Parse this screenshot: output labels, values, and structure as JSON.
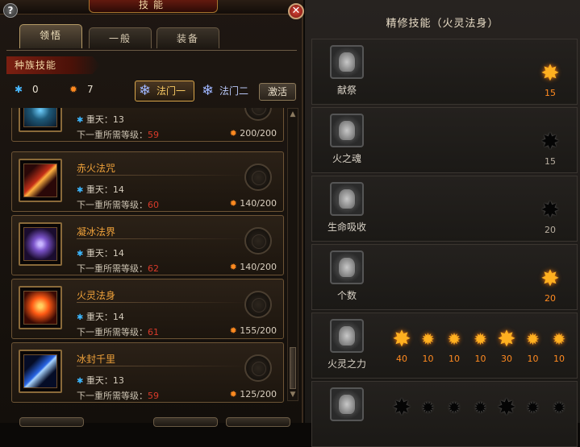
{
  "left": {
    "title": "技能",
    "help_icon": "question-icon",
    "tabs": [
      {
        "label": "领悟",
        "active": true
      },
      {
        "label": "一般",
        "active": false
      },
      {
        "label": "装备",
        "active": false
      }
    ],
    "race_label": "种族技能",
    "resources": [
      {
        "icon": "blue-star-icon",
        "value": "0"
      },
      {
        "icon": "fire-star-icon",
        "value": "7"
      }
    ],
    "tome_buttons": [
      {
        "label": "法门一",
        "active": true
      },
      {
        "label": "法门二",
        "active": false
      }
    ],
    "activate_label": "激活",
    "skills": [
      {
        "name": "",
        "tier_label": "重天：13",
        "req_label": "下一重所需等级：",
        "req_level": "59",
        "cost": "200/200",
        "colors": [
          "#0c1a2a",
          "#1e5a7a"
        ]
      },
      {
        "name": "赤火法咒",
        "tier_label": "重天：14",
        "req_label": "下一重所需等级：",
        "req_level": "60",
        "cost": "140/200",
        "colors": [
          "#2a0808",
          "#c43018"
        ]
      },
      {
        "name": "凝冰法界",
        "tier_label": "重天：14",
        "req_label": "下一重所需等级：",
        "req_level": "62",
        "cost": "140/200",
        "colors": [
          "#1a0c2e",
          "#7a52c8"
        ]
      },
      {
        "name": "火灵法身",
        "tier_label": "重天：14",
        "req_label": "下一重所需等级：",
        "req_level": "61",
        "cost": "155/200",
        "colors": [
          "#3a0a04",
          "#ff5a14"
        ]
      },
      {
        "name": "冰封千里",
        "tier_label": "重天：13",
        "req_label": "下一重所需等级：",
        "req_level": "59",
        "cost": "125/200",
        "colors": [
          "#050c26",
          "#2a66e6"
        ]
      }
    ],
    "scroll": {
      "position": 0.85
    }
  },
  "right": {
    "title": "精修技能（火灵法身）",
    "rows": [
      {
        "label": "献祭",
        "nodes": [
          {
            "value": "15",
            "on": true,
            "big": true
          }
        ]
      },
      {
        "label": "火之魂",
        "nodes": [
          {
            "value": "15",
            "on": false,
            "big": true
          }
        ]
      },
      {
        "label": "生命吸收",
        "nodes": [
          {
            "value": "20",
            "on": false,
            "big": true
          }
        ]
      },
      {
        "label": "个数",
        "nodes": [
          {
            "value": "20",
            "on": true,
            "big": true
          }
        ]
      },
      {
        "label": "火灵之力",
        "nodes": [
          {
            "value": "40",
            "on": true,
            "big": true
          },
          {
            "value": "10",
            "on": true,
            "big": false
          },
          {
            "value": "10",
            "on": true,
            "big": false
          },
          {
            "value": "10",
            "on": true,
            "big": false
          },
          {
            "value": "30",
            "on": true,
            "big": true
          },
          {
            "value": "10",
            "on": true,
            "big": false
          },
          {
            "value": "10",
            "on": true,
            "big": false
          }
        ]
      },
      {
        "label": "",
        "nodes": [
          {
            "value": "",
            "on": false,
            "big": true
          },
          {
            "value": "",
            "on": false,
            "big": false
          },
          {
            "value": "",
            "on": false,
            "big": false
          },
          {
            "value": "",
            "on": false,
            "big": false
          },
          {
            "value": "",
            "on": false,
            "big": true
          },
          {
            "value": "",
            "on": false,
            "big": false
          },
          {
            "value": "",
            "on": false,
            "big": false
          }
        ]
      }
    ],
    "close_icon": "close-icon"
  }
}
